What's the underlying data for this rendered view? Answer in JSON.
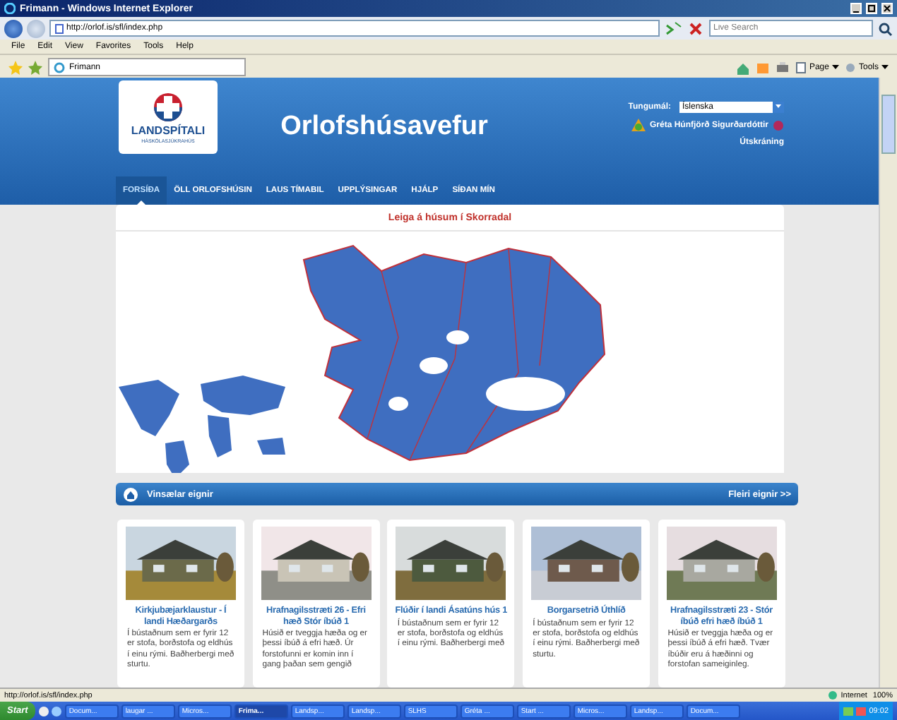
{
  "browser": {
    "title": "Frimann - Windows Internet Explorer",
    "address": "http://orlof.is/sfl/index.php",
    "search": {
      "placeholder": "Live Search"
    },
    "menu": [
      "File",
      "Edit",
      "View",
      "Favorites",
      "Tools",
      "Help"
    ],
    "tab": "Frimann",
    "tools": [
      "Page",
      "Tools"
    ]
  },
  "site": {
    "logo": {
      "name": "LANDSPÍTALI",
      "tagline": "HÁSKÓLASJÚKRAHÚS"
    },
    "title": "Orlofshúsavefur",
    "language_label": "Tungumál:",
    "language": "Íslenska",
    "user": "Gréta Húnfjörð Sigurðardóttir",
    "logout": "Útskráning",
    "nav": [
      {
        "label": "FORSÍÐA",
        "selected": true
      },
      {
        "label": "ÖLL ORLOFSHÚSIN",
        "selected": false
      },
      {
        "label": "LAUS TÍMABIL",
        "selected": false
      },
      {
        "label": "UPPLÝSINGAR",
        "selected": false
      },
      {
        "label": "HJÁLP",
        "selected": false
      },
      {
        "label": "SÍÐAN MÍN",
        "selected": false
      }
    ],
    "map_panel": {
      "heading": "Leiga á húsum í Skorradal"
    },
    "popular": {
      "title": "Vinsælar eignir",
      "more": "Fleiri eignir >>"
    },
    "properties": [
      {
        "title": "Kirkjubæjarklaustur - Í landi Hæðargarðs",
        "description": "Í bústaðnum sem er fyrir 12 er stofa, borðstofa og eldhús í einu rými. Baðherbergi með sturtu."
      },
      {
        "title": "Hrafnagilsstræti 26 - Efri hæð Stór íbúð 1",
        "description": "Húsið er tveggja hæða og er þessi íbúð á efri hæð. Úr forstofunni er komin inn í gang þaðan sem gengið"
      },
      {
        "title": "Flúðir í landi Ásatúns hús 1",
        "description": "Í bústaðnum sem er fyrir 12 er stofa, borðstofa og eldhús í einu rými. Baðherbergi með"
      },
      {
        "title": "Borgarsetrið Úthlíð",
        "description": "Í bústaðnum sem er fyrir 12 er stofa, borðstofa og eldhús í einu rými. Baðherbergi með sturtu."
      },
      {
        "title": "Hrafnagilsstræti 23 - Stór íbúð efri hæð íbúð 1",
        "description": "Húsið er tveggja hæða og er þessi íbúð á efri hæð. Tvær íbúðir eru á hæðinni og forstofan sameiginleg."
      }
    ]
  },
  "status_bar": {
    "url": "http://orlof.is/sfl/index.php",
    "zone": "Internet",
    "zoom": "100%"
  },
  "taskbar": {
    "start": "Start",
    "items": [
      {
        "label": "Docum...",
        "selected": false
      },
      {
        "label": "laugar ...",
        "selected": false
      },
      {
        "label": "Micros...",
        "selected": false
      },
      {
        "label": "Frima...",
        "selected": true
      },
      {
        "label": "Landsp...",
        "selected": false
      },
      {
        "label": "Landsp...",
        "selected": false
      },
      {
        "label": "SLHS",
        "selected": false
      },
      {
        "label": "Gréta ...",
        "selected": false
      },
      {
        "label": "Start ...",
        "selected": false
      },
      {
        "label": "Micros...",
        "selected": false
      },
      {
        "label": "Landsp...",
        "selected": false
      },
      {
        "label": "Docum...",
        "selected": false
      }
    ],
    "clock": "09:02"
  }
}
